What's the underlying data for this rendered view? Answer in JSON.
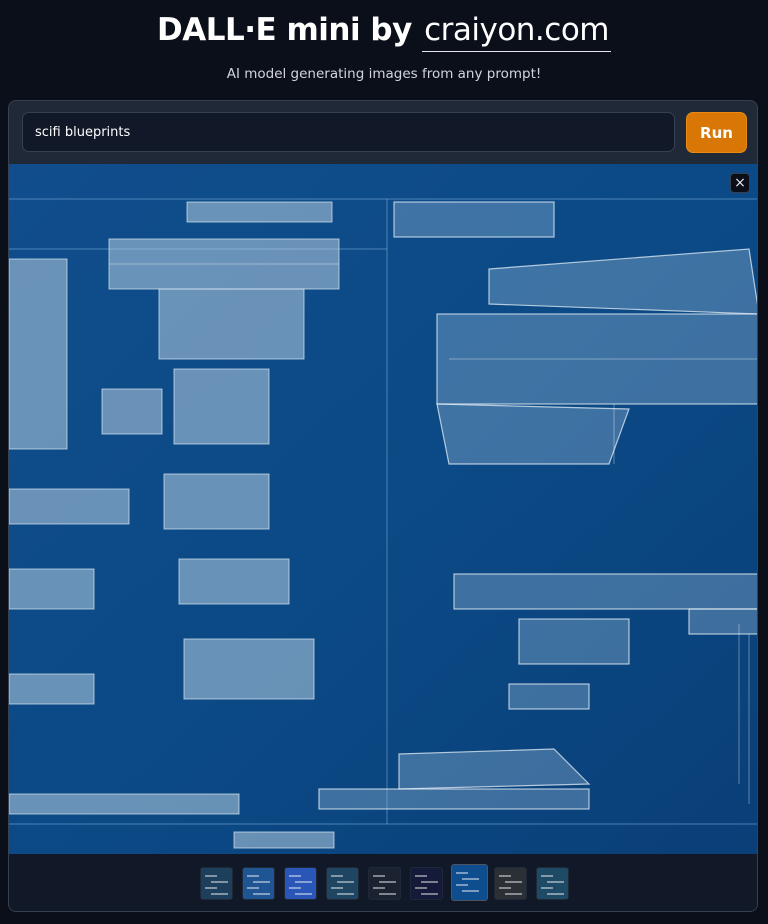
{
  "header": {
    "title_prefix": "DALL·E mini by",
    "title_brand": "craiyon.com",
    "subtitle": "AI model generating images from any prompt!"
  },
  "prompt": {
    "value": "scifi blueprints",
    "run_label": "Run"
  },
  "gallery": {
    "close_label": "×",
    "selected_index": 6,
    "thumbnails": [
      {
        "name": "thumbnail-1",
        "color": "#1d3f5c"
      },
      {
        "name": "thumbnail-2",
        "color": "#1f5593"
      },
      {
        "name": "thumbnail-3",
        "color": "#2a56b8"
      },
      {
        "name": "thumbnail-4",
        "color": "#1e4662"
      },
      {
        "name": "thumbnail-5",
        "color": "#1b2230"
      },
      {
        "name": "thumbnail-6",
        "color": "#151a3a"
      },
      {
        "name": "thumbnail-7",
        "color": "#0e4d8e"
      },
      {
        "name": "thumbnail-8",
        "color": "#2b2f36"
      },
      {
        "name": "thumbnail-9",
        "color": "#1f4a66"
      }
    ]
  },
  "colors": {
    "background": "#0b0f19",
    "panel": "#1f2937",
    "accent": "#d97706",
    "blueprint": "#0e4d8e"
  }
}
